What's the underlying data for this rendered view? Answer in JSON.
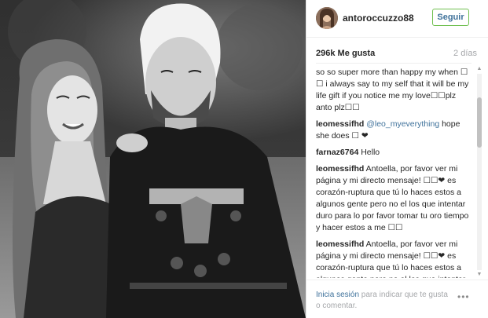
{
  "header": {
    "username": "antoroccuzzo88",
    "follow_label": "Seguir",
    "avatar": "profile-avatar"
  },
  "stats": {
    "likes": "296k Me gusta",
    "age": "2 días"
  },
  "comments": [
    {
      "user": "",
      "pre": "",
      "mention": "",
      "text": "you notice me I will be really really really so so super more than happy my when ☐ ☐ i always say to my self that it will be my life gift if you notice me my love☐☐plz anto plz☐☐"
    },
    {
      "user": "leomessifhd",
      "pre": "",
      "mention": "@leo_myeverything",
      "text": " hope she does ☐ ❤"
    },
    {
      "user": "farnaz6764",
      "pre": "",
      "mention": "",
      "text": "Hello"
    },
    {
      "user": "leomessifhd",
      "pre": "",
      "mention": "",
      "text": "Antoella, por favor ver mi página y mi directo mensaje! ☐☐❤ es corazón-ruptura que tú lo haces estos a algunos gente pero no el los que intentar duro para lo por favor tomar tu oro tiempo y hacer estos a me ☐☐"
    },
    {
      "user": "leomessifhd",
      "pre": "",
      "mention": "",
      "text": "Antoella, por favor ver mi página y mi directo mensaje! ☐☐❤ es corazón-ruptura que tú lo haces estos a algunos gente pero no el los que intentar duro para lo por favor tomar tu oro tiempo y hacer estos a me ☐☐"
    }
  ],
  "footer": {
    "login_label": "Inicia sesión",
    "rest_label": " para indicar que te gusta o comentar.",
    "more_label": "•••"
  },
  "scrollbar": {
    "up": "▲",
    "down": "▼"
  }
}
